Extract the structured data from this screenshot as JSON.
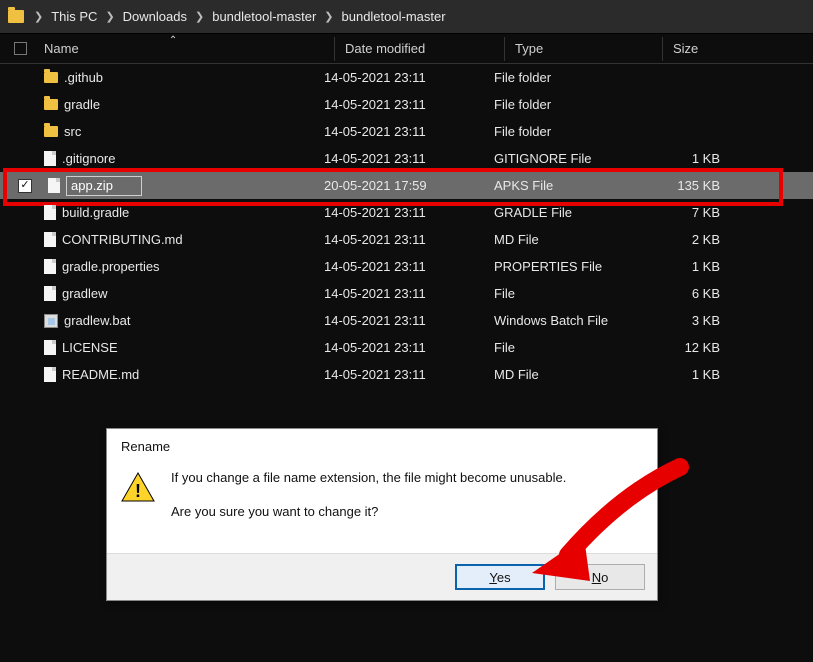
{
  "breadcrumbs": [
    "This PC",
    "Downloads",
    "bundletool-master",
    "bundletool-master"
  ],
  "columns": {
    "name": "Name",
    "date": "Date modified",
    "type": "Type",
    "size": "Size"
  },
  "rows": [
    {
      "icon": "folder",
      "name": ".github",
      "date": "14-05-2021 23:11",
      "type": "File folder",
      "size": ""
    },
    {
      "icon": "folder",
      "name": "gradle",
      "date": "14-05-2021 23:11",
      "type": "File folder",
      "size": ""
    },
    {
      "icon": "folder",
      "name": "src",
      "date": "14-05-2021 23:11",
      "type": "File folder",
      "size": ""
    },
    {
      "icon": "file",
      "name": ".gitignore",
      "date": "14-05-2021 23:11",
      "type": "GITIGNORE File",
      "size": "1 KB"
    },
    {
      "icon": "file",
      "name": "app.zip",
      "date": "20-05-2021 17:59",
      "type": "APKS File",
      "size": "135 KB",
      "selected": true,
      "editing": true
    },
    {
      "icon": "file",
      "name": "build.gradle",
      "date": "14-05-2021 23:11",
      "type": "GRADLE File",
      "size": "7 KB"
    },
    {
      "icon": "file",
      "name": "CONTRIBUTING.md",
      "date": "14-05-2021 23:11",
      "type": "MD File",
      "size": "2 KB"
    },
    {
      "icon": "file",
      "name": "gradle.properties",
      "date": "14-05-2021 23:11",
      "type": "PROPERTIES File",
      "size": "1 KB"
    },
    {
      "icon": "file",
      "name": "gradlew",
      "date": "14-05-2021 23:11",
      "type": "File",
      "size": "6 KB"
    },
    {
      "icon": "bat",
      "name": "gradlew.bat",
      "date": "14-05-2021 23:11",
      "type": "Windows Batch File",
      "size": "3 KB"
    },
    {
      "icon": "file",
      "name": "LICENSE",
      "date": "14-05-2021 23:11",
      "type": "File",
      "size": "12 KB"
    },
    {
      "icon": "file",
      "name": "README.md",
      "date": "14-05-2021 23:11",
      "type": "MD File",
      "size": "1 KB"
    }
  ],
  "dialog": {
    "title": "Rename",
    "line1": "If you change a file name extension, the file might become unusable.",
    "line2": "Are you sure you want to change it?",
    "yes": "Yes",
    "no": "No"
  }
}
